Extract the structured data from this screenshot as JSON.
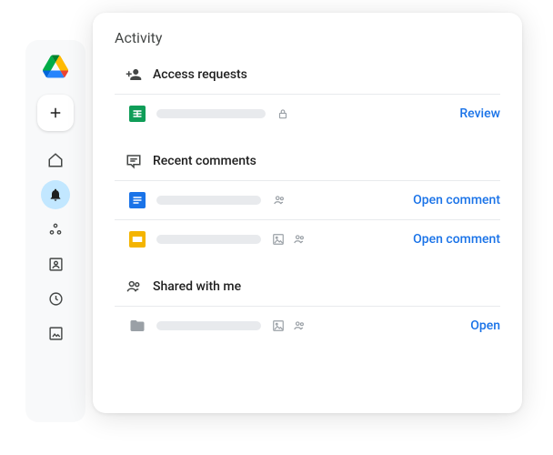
{
  "panel": {
    "title": "Activity"
  },
  "sections": {
    "access": {
      "label": "Access requests",
      "rows": [
        {
          "action": "Review"
        }
      ]
    },
    "comments": {
      "label": "Recent comments",
      "rows": [
        {
          "action": "Open comment"
        },
        {
          "action": "Open comment"
        }
      ]
    },
    "shared": {
      "label": "Shared with me",
      "rows": [
        {
          "action": "Open"
        }
      ]
    }
  }
}
